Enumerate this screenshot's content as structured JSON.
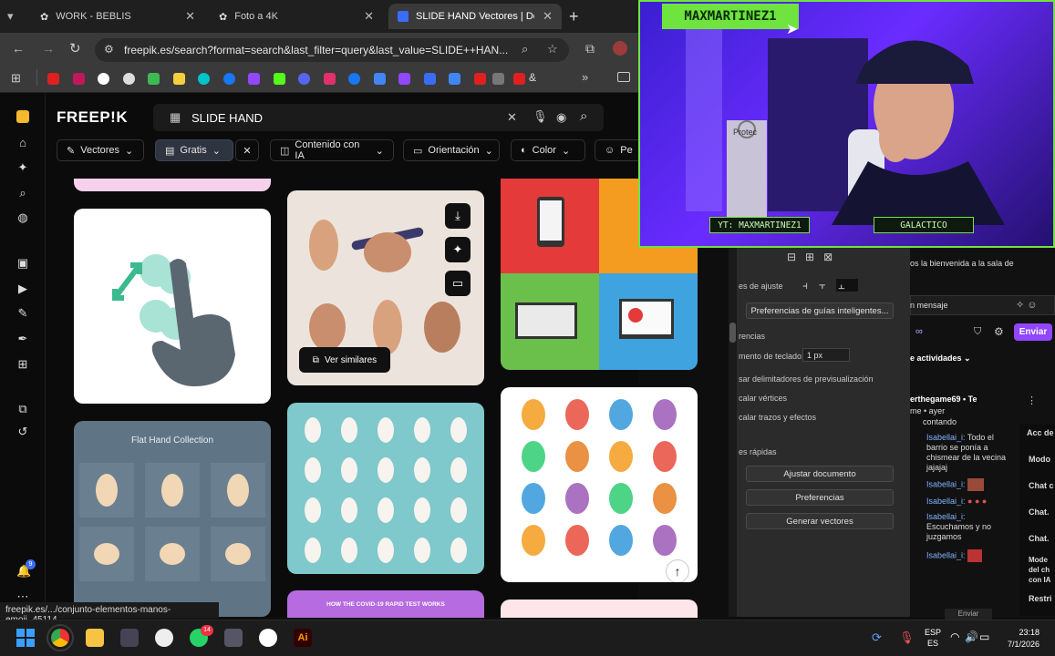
{
  "tabs": [
    {
      "label": "WORK - BEBLIS",
      "active": false
    },
    {
      "label": "Foto a 4K",
      "active": false
    },
    {
      "label": "SLIDE HAND Vectores | Desc",
      "active": true
    }
  ],
  "address": {
    "url": "freepik.es/search?format=search&last_filter=query&last_value=SLIDE++HAN..."
  },
  "freepik": {
    "logo": "FREEP!K",
    "search_query": "SLIDE HAND",
    "filters": [
      "Vectores",
      "Gratis",
      "Contenido con IA",
      "Orientación",
      "Color",
      "Pe"
    ],
    "ver_similares": "Ver similares",
    "flat_hand_title": "Flat Hand Collection",
    "covid_banner": "HOW THE COVID-19 RAPID TEST WORKS",
    "status_url": "freepik.es/.../conjunto-elementos-manos-emoji_45114..."
  },
  "stream": {
    "name": "MAXMARTINEZ1",
    "yt_label": "YT: MAXMARTINEZ1",
    "game_label": "GALACTICO",
    "mic_brand": "Protec"
  },
  "illustrator": {
    "align_label": "es de ajuste",
    "smart_guides": "Preferencias de guías inteligentes...",
    "tolerancias": "rencias",
    "keyboard_inc": "mento de teclado:",
    "keyboard_val": "1 px",
    "preview_bounds": "sar delimitadores de previsualización",
    "scale_corners": "calar vértices",
    "scale_strokes": "calar trazos y efectos",
    "quick_actions": "es rápidas",
    "buttons": [
      "Ajustar documento",
      "Preferencias",
      "Generar vectores"
    ]
  },
  "chat": {
    "welcome": "os la bienvenida a la sala de",
    "input_placeholder": "n mensaje",
    "send": "Enviar",
    "activities": "e actividades",
    "user_header": "erthegame69 • Te",
    "user_sub": "me • ayer",
    "messages": [
      {
        "user": "",
        "text": "contando"
      },
      {
        "user": "Isabellai_i:",
        "text": "Todo el barrio se ponía a chismear de la vecina jajajaj"
      },
      {
        "user": "Isabellai_i:",
        "text": ""
      },
      {
        "user": "Isabellai_i:",
        "text": ""
      },
      {
        "user": "Isabellai_i:",
        "text": "Escuchamos y no juzgamos"
      },
      {
        "user": "Isabellai_i:",
        "text": ""
      }
    ],
    "side_items": [
      "Acc de",
      "Modo",
      "Chat c",
      "Chat.",
      "Chat.",
      "Mode del ch con IA",
      "Restri"
    ],
    "send2": "Enviar"
  },
  "taskbar": {
    "lang1": "ESP",
    "lang2": "ES",
    "time": "23:18",
    "date": "7/1/2026",
    "badge": "14"
  },
  "bell_badge": "9"
}
